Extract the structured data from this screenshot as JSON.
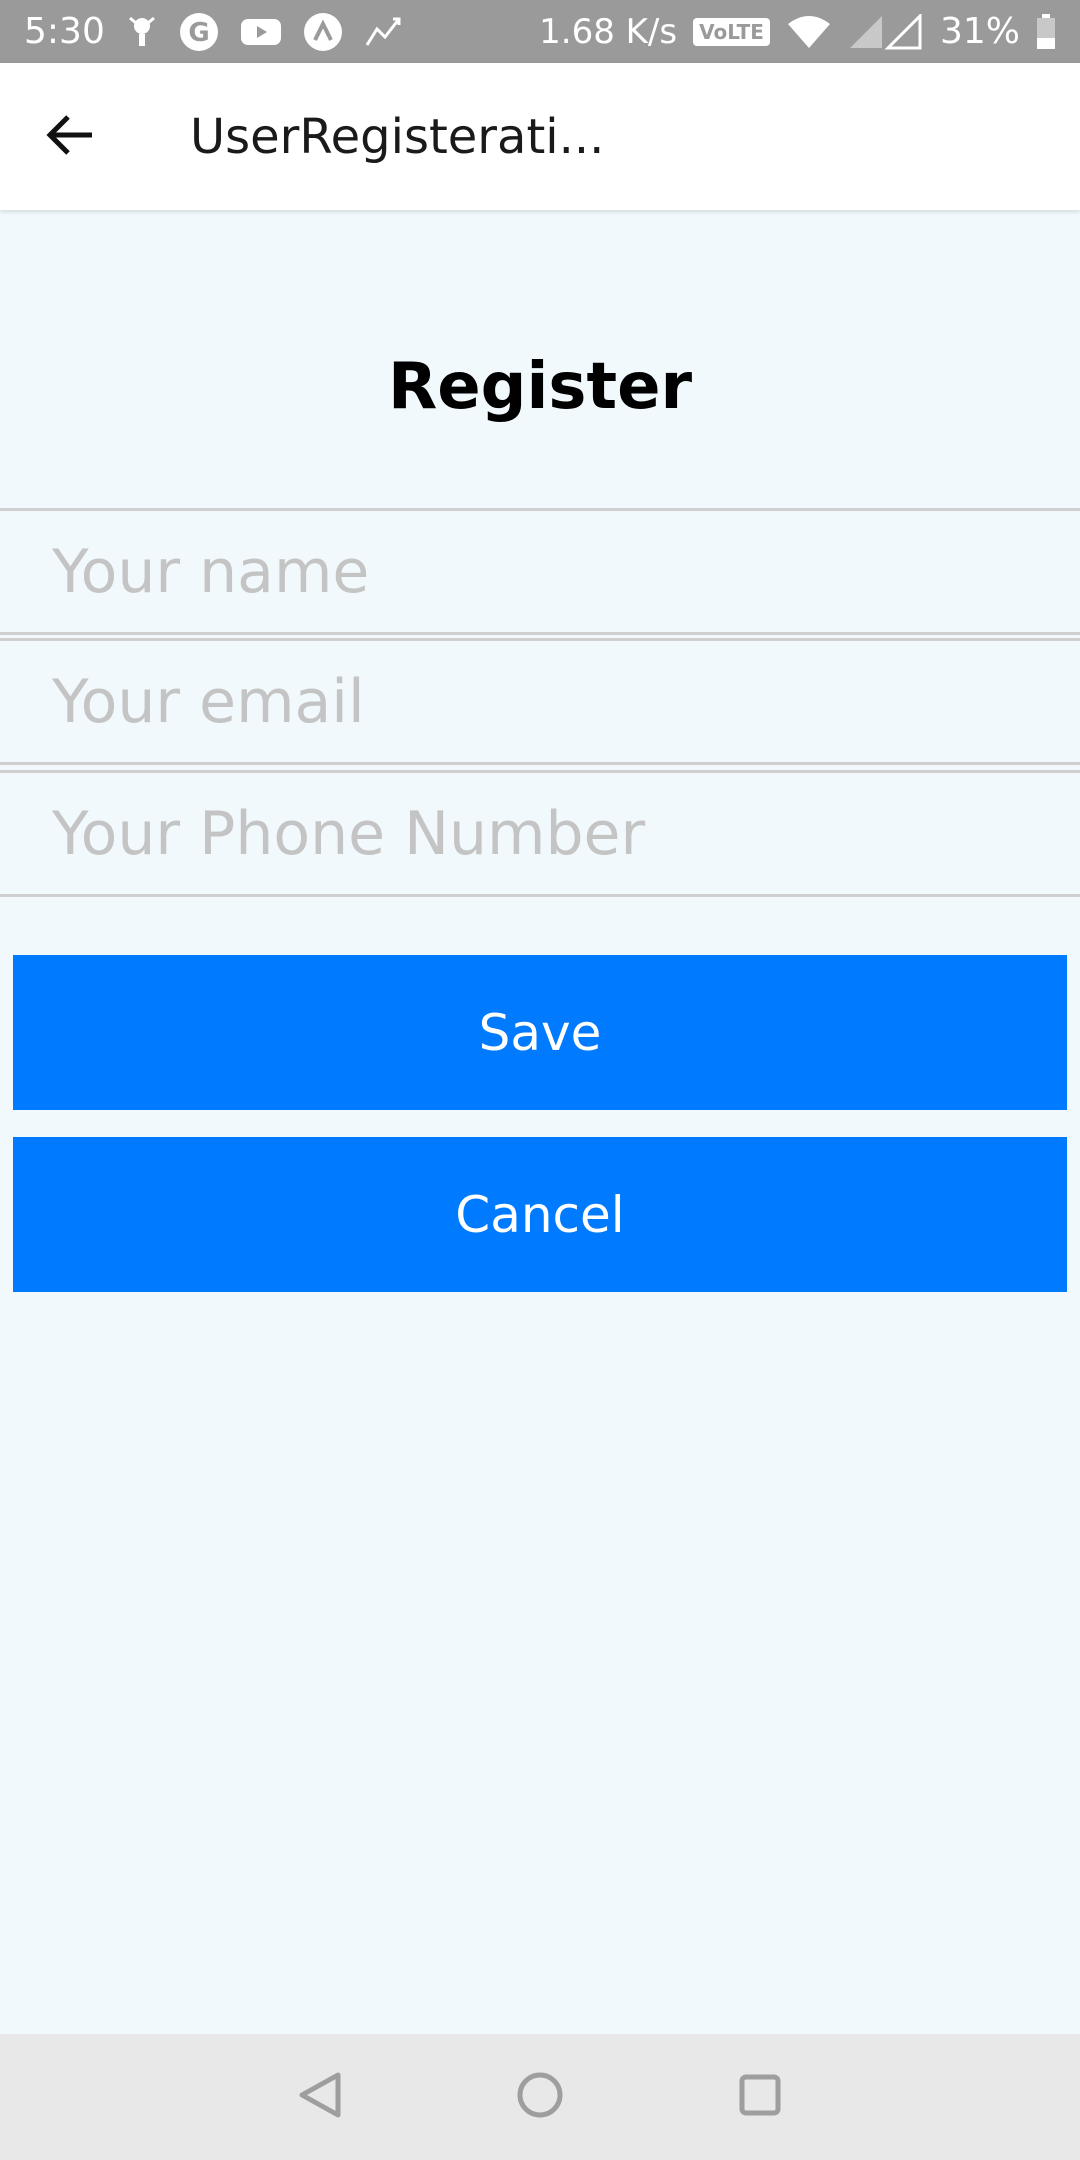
{
  "status_bar": {
    "time": "5:30",
    "net_speed": "1.68 K/s",
    "volte": "VoLTE",
    "battery": "31%",
    "icons": [
      "notification-icon",
      "google-icon",
      "youtube-icon",
      "app-icon",
      "activity-icon",
      "wifi-icon",
      "signal-icon",
      "battery-icon"
    ]
  },
  "app_bar": {
    "title": "UserRegisterati..."
  },
  "form": {
    "heading": "Register",
    "name_placeholder": "Your name",
    "email_placeholder": "Your email",
    "phone_placeholder": "Your Phone Number",
    "save_label": "Save",
    "cancel_label": "Cancel"
  },
  "colors": {
    "background": "#f1f9fd",
    "primary": "#007aff",
    "status_bar": "#9a9a9a",
    "nav_bar": "#e8e8e8"
  }
}
